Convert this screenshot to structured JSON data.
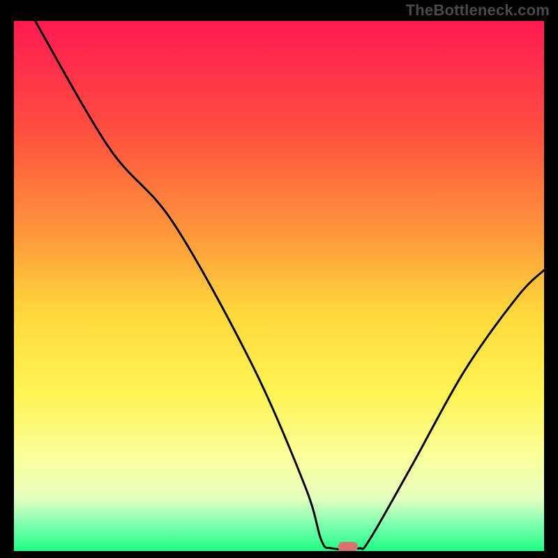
{
  "watermark": "TheBottleneck.com",
  "chart_data": {
    "type": "line",
    "title": "",
    "xlabel": "",
    "ylabel": "",
    "xlim": [
      0,
      100
    ],
    "ylim": [
      0,
      100
    ],
    "gradient_stops": [
      {
        "offset": 0,
        "color": "#ff1a52"
      },
      {
        "offset": 20,
        "color": "#ff4d3f"
      },
      {
        "offset": 40,
        "color": "#ff973b"
      },
      {
        "offset": 55,
        "color": "#ffd83b"
      },
      {
        "offset": 70,
        "color": "#fff452"
      },
      {
        "offset": 82,
        "color": "#fbff9a"
      },
      {
        "offset": 90,
        "color": "#e6ffbf"
      },
      {
        "offset": 95,
        "color": "#7dffb0"
      },
      {
        "offset": 100,
        "color": "#1eff82"
      }
    ],
    "curve_points": [
      {
        "x": 4,
        "y": 100
      },
      {
        "x": 18,
        "y": 76
      },
      {
        "x": 30,
        "y": 62
      },
      {
        "x": 45,
        "y": 35
      },
      {
        "x": 55,
        "y": 12
      },
      {
        "x": 58,
        "y": 2
      },
      {
        "x": 60,
        "y": 0.5
      },
      {
        "x": 65,
        "y": 0.5
      },
      {
        "x": 67,
        "y": 2
      },
      {
        "x": 75,
        "y": 16
      },
      {
        "x": 85,
        "y": 34
      },
      {
        "x": 95,
        "y": 48
      },
      {
        "x": 100,
        "y": 53
      }
    ],
    "marker": {
      "x": 63,
      "y": 0.8,
      "color": "#d9736f"
    }
  }
}
